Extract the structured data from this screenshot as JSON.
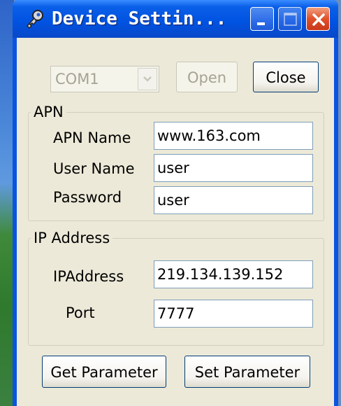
{
  "window": {
    "title": "Device Settin..."
  },
  "toolbar": {
    "port_value": "COM1",
    "open_label": "Open",
    "close_label": "Close"
  },
  "apn": {
    "legend": "APN",
    "apn_name_label": "APN Name",
    "apn_name_value": "www.163.com",
    "user_name_label": "User Name",
    "user_name_value": "user",
    "password_label": "Password",
    "password_value": "user"
  },
  "ip": {
    "legend": "IP Address",
    "ip_label": "IPAddress",
    "ip_value": "219.134.139.152",
    "port_label": "Port",
    "port_value": "7777"
  },
  "actions": {
    "get_label": "Get Parameter",
    "set_label": "Set Parameter"
  },
  "colors": {
    "titlebar": "#0052e0",
    "client_bg": "#ece9d8",
    "close_button": "#e0502a"
  },
  "icons": {
    "title": "key-icon",
    "minimize": "minimize-icon",
    "maximize": "maximize-icon",
    "close": "close-icon",
    "dropdown": "chevron-down-icon"
  }
}
